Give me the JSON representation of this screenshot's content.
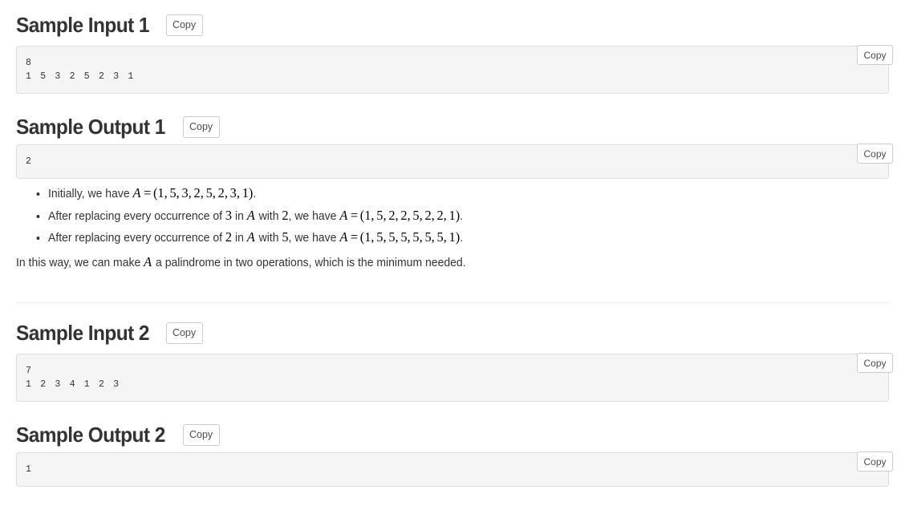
{
  "sections": [
    {
      "id": "sample-input-1",
      "title": "Sample Input 1",
      "copy_label": "Copy",
      "pre_copy_label": "Copy",
      "content": "8\n1 5 3 2 5 2 3 1"
    },
    {
      "id": "sample-output-1",
      "title": "Sample Output 1",
      "copy_label": "Copy",
      "pre_copy_label": "Copy",
      "content": "2"
    },
    {
      "id": "sample-input-2",
      "title": "Sample Input 2",
      "copy_label": "Copy",
      "pre_copy_label": "Copy",
      "content": "7\n1 2 3 4 1 2 3"
    },
    {
      "id": "sample-output-2",
      "title": "Sample Output 2",
      "copy_label": "Copy",
      "pre_copy_label": "Copy",
      "content": "1"
    }
  ],
  "explanation": {
    "bullets": [
      {
        "lead": "Initially, we have ",
        "math_var": "A",
        "eq": "=",
        "sequence": [
          1,
          5,
          3,
          2,
          5,
          2,
          3,
          1
        ],
        "mid": "",
        "from_value": "",
        "to_value": "",
        "tail": "."
      },
      {
        "lead": "After replacing every occurrence of ",
        "from_value": "3",
        "in_word": " in ",
        "math_var": "A",
        "with_word": " with ",
        "to_value": "2",
        "mid": ", we have ",
        "eq": "=",
        "sequence": [
          1,
          5,
          2,
          2,
          5,
          2,
          2,
          1
        ],
        "tail": "."
      },
      {
        "lead": "After replacing every occurrence of ",
        "from_value": "2",
        "in_word": " in ",
        "math_var": "A",
        "with_word": " with ",
        "to_value": "5",
        "mid": ", we have ",
        "eq": "=",
        "sequence": [
          1,
          5,
          5,
          5,
          5,
          5,
          5,
          1
        ],
        "tail": "."
      }
    ],
    "tail_before": "In this way, we can make ",
    "tail_var": "A",
    "tail_after": " a palindrome in two operations, which is the minimum needed."
  },
  "colors": {
    "text": "#333333",
    "pre_background": "#f5f5f5",
    "pre_border": "#dddddd",
    "button_border": "#cccccc",
    "divider": "#eeeeee"
  }
}
